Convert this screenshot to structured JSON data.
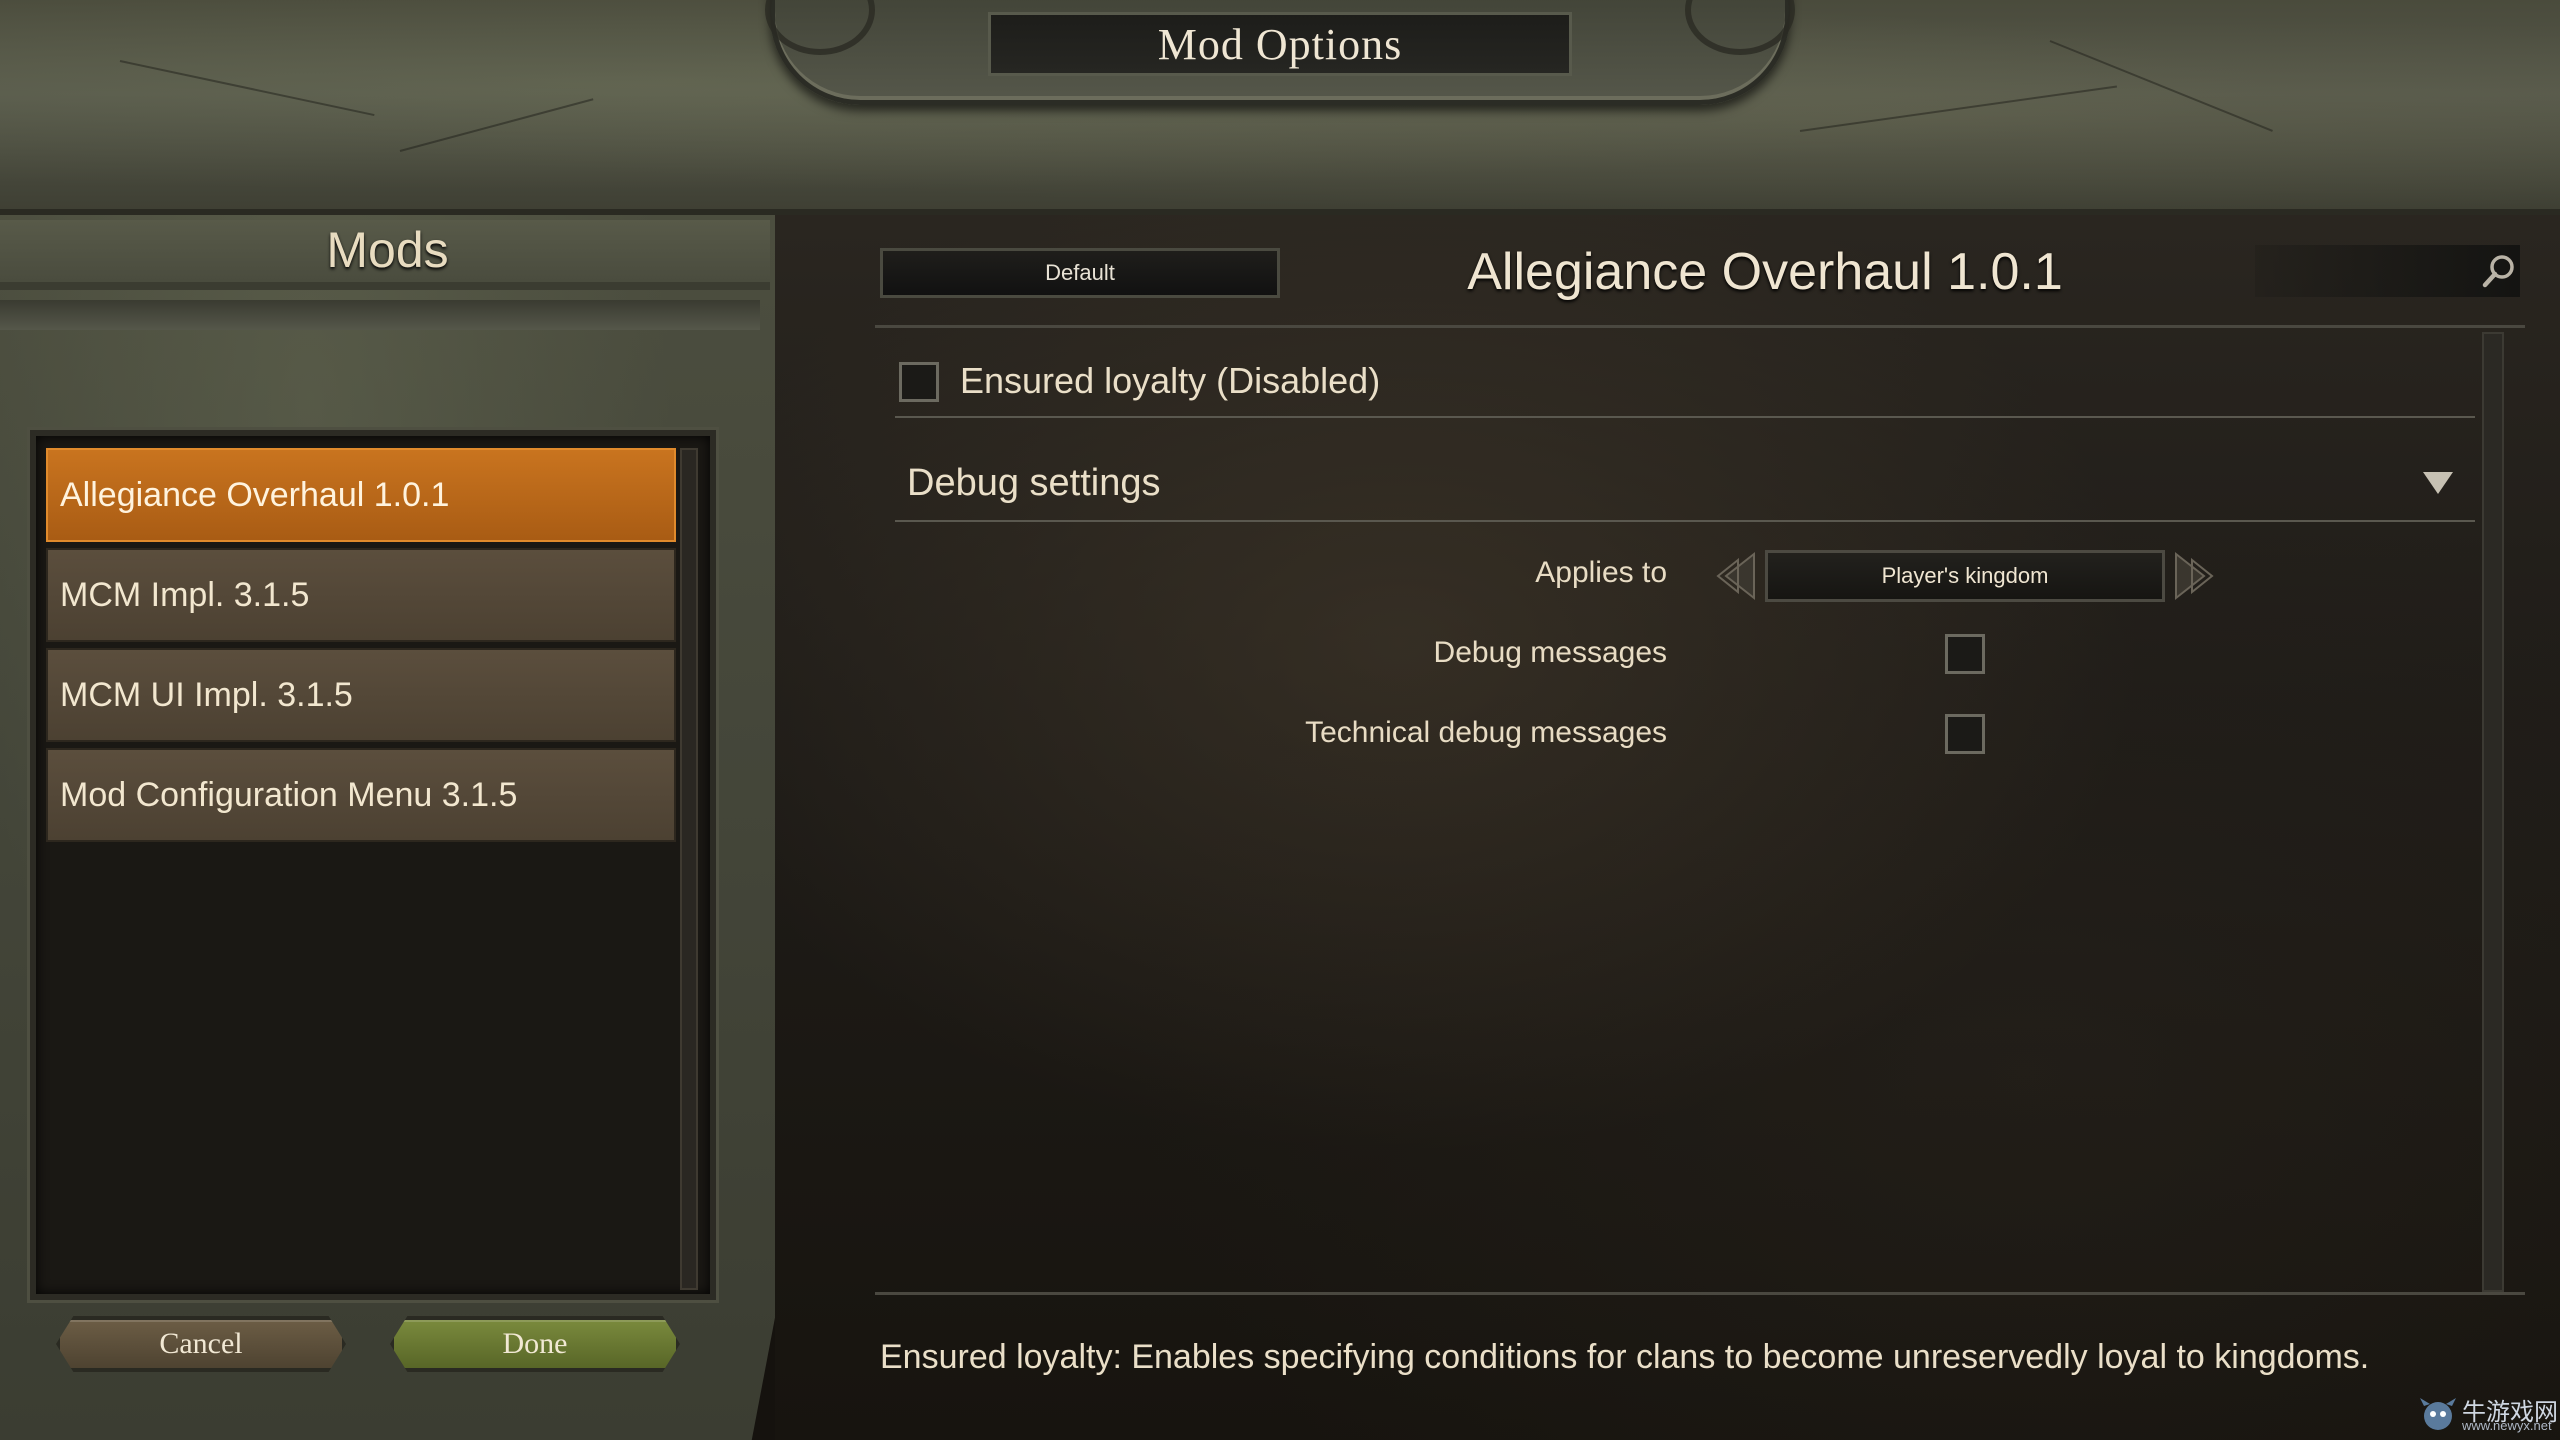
{
  "window": {
    "title": "Mod Options"
  },
  "sidebar": {
    "title": "Mods",
    "mods": [
      {
        "label": "Allegiance Overhaul 1.0.1",
        "selected": true
      },
      {
        "label": "MCM Impl. 3.1.5",
        "selected": false
      },
      {
        "label": "MCM UI Impl. 3.1.5",
        "selected": false
      },
      {
        "label": "Mod Configuration Menu 3.1.5",
        "selected": false
      }
    ],
    "cancel_label": "Cancel",
    "done_label": "Done"
  },
  "main": {
    "preset_label": "Default",
    "mod_title": "Allegiance Overhaul 1.0.1",
    "search": {
      "value": "",
      "placeholder": ""
    },
    "ensured_loyalty": {
      "label": "Ensured loyalty (Disabled)",
      "checked": false
    },
    "debug_group": {
      "title": "Debug settings",
      "applies_to": {
        "label": "Applies to",
        "value": "Player's kingdom"
      },
      "debug_messages": {
        "label": "Debug messages",
        "checked": false
      },
      "technical_debug_messages": {
        "label": "Technical debug messages",
        "checked": false
      }
    },
    "description": "Ensured loyalty: Enables specifying conditions for clans to become unreservedly loyal to kingdoms."
  },
  "watermark": {
    "text": "牛游戏网",
    "url": "www.newyx.net"
  },
  "colors": {
    "selected_item": "#c9741f",
    "list_item": "#5b4e3d",
    "done_button": "#7a8a3d",
    "text": "#eadfc8"
  },
  "icons": {
    "search": "search-icon",
    "collapse": "triangle-down-icon",
    "prev": "chevron-left-icon",
    "next": "chevron-right-icon"
  }
}
